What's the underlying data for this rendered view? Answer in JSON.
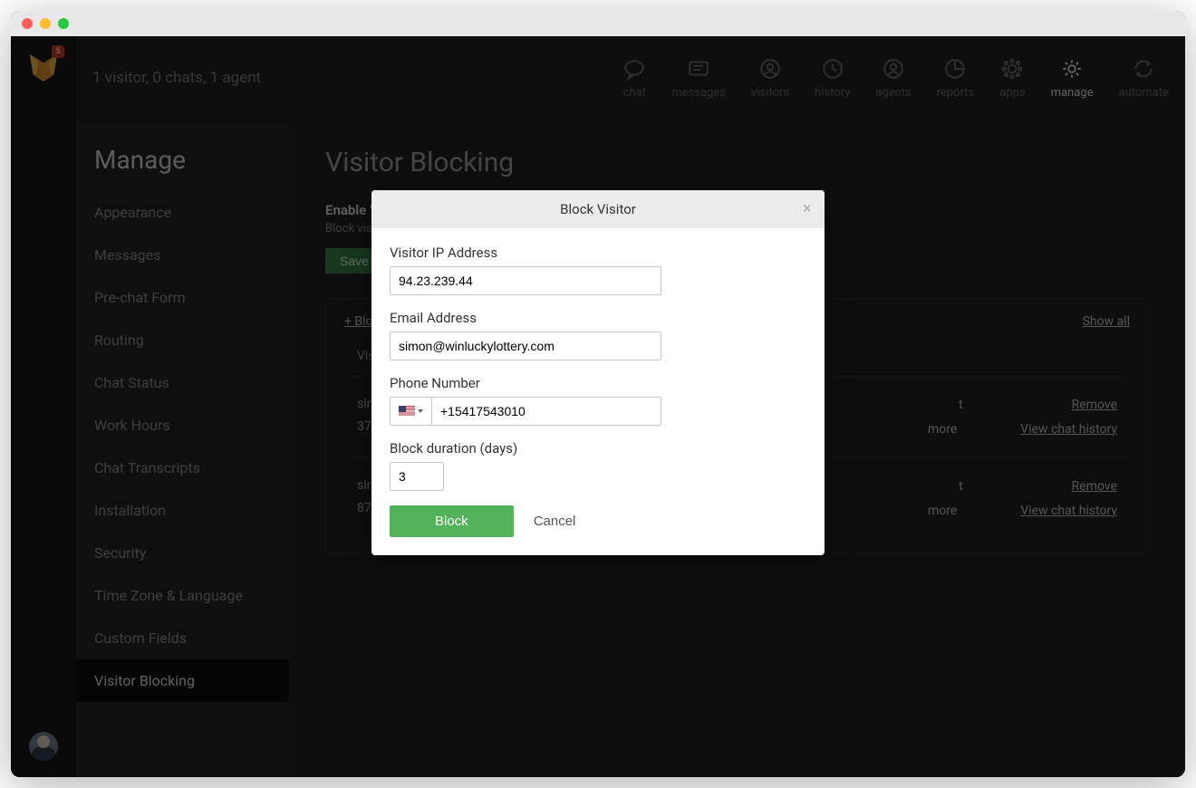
{
  "status_text": "1 visitor, 0 chats, 1 agent",
  "logo_badge": "5",
  "topnav": [
    {
      "label": "chat"
    },
    {
      "label": "messages"
    },
    {
      "label": "visitors"
    },
    {
      "label": "history"
    },
    {
      "label": "agents"
    },
    {
      "label": "reports"
    },
    {
      "label": "apps"
    },
    {
      "label": "manage"
    },
    {
      "label": "automate"
    }
  ],
  "sidebar": {
    "title": "Manage",
    "items": [
      "Appearance",
      "Messages",
      "Pre-chat Form",
      "Routing",
      "Chat Status",
      "Work Hours",
      "Chat Transcripts",
      "Installation",
      "Security",
      "Time Zone & Language",
      "Custom Fields",
      "Visitor Blocking"
    ]
  },
  "page": {
    "title": "Visitor Blocking",
    "enable_label": "Enable Visitor Blocking",
    "enable_desc": "Block visitors from chatting with your agents.",
    "save": "Save"
  },
  "panel": {
    "add_link": "+ Block a visitor",
    "show_all": "Show all",
    "col_visitor": "Visitor",
    "rows": [
      {
        "left1": "simon",
        "left2": "37.",
        "right1": "t",
        "right2": "more",
        "remove": "Remove",
        "history": "View chat history"
      },
      {
        "left1": "simon",
        "left2": "87.",
        "right1": "t",
        "right2": "more",
        "remove": "Remove",
        "history": "View chat history"
      }
    ]
  },
  "modal": {
    "title": "Block Visitor",
    "ip_label": "Visitor IP Address",
    "ip_value": "94.23.239.44",
    "email_label": "Email Address",
    "email_value": "simon@winluckylottery.com",
    "phone_label": "Phone Number",
    "phone_value": "+15417543010",
    "duration_label": "Block duration (days)",
    "duration_value": "3",
    "block": "Block",
    "cancel": "Cancel"
  }
}
